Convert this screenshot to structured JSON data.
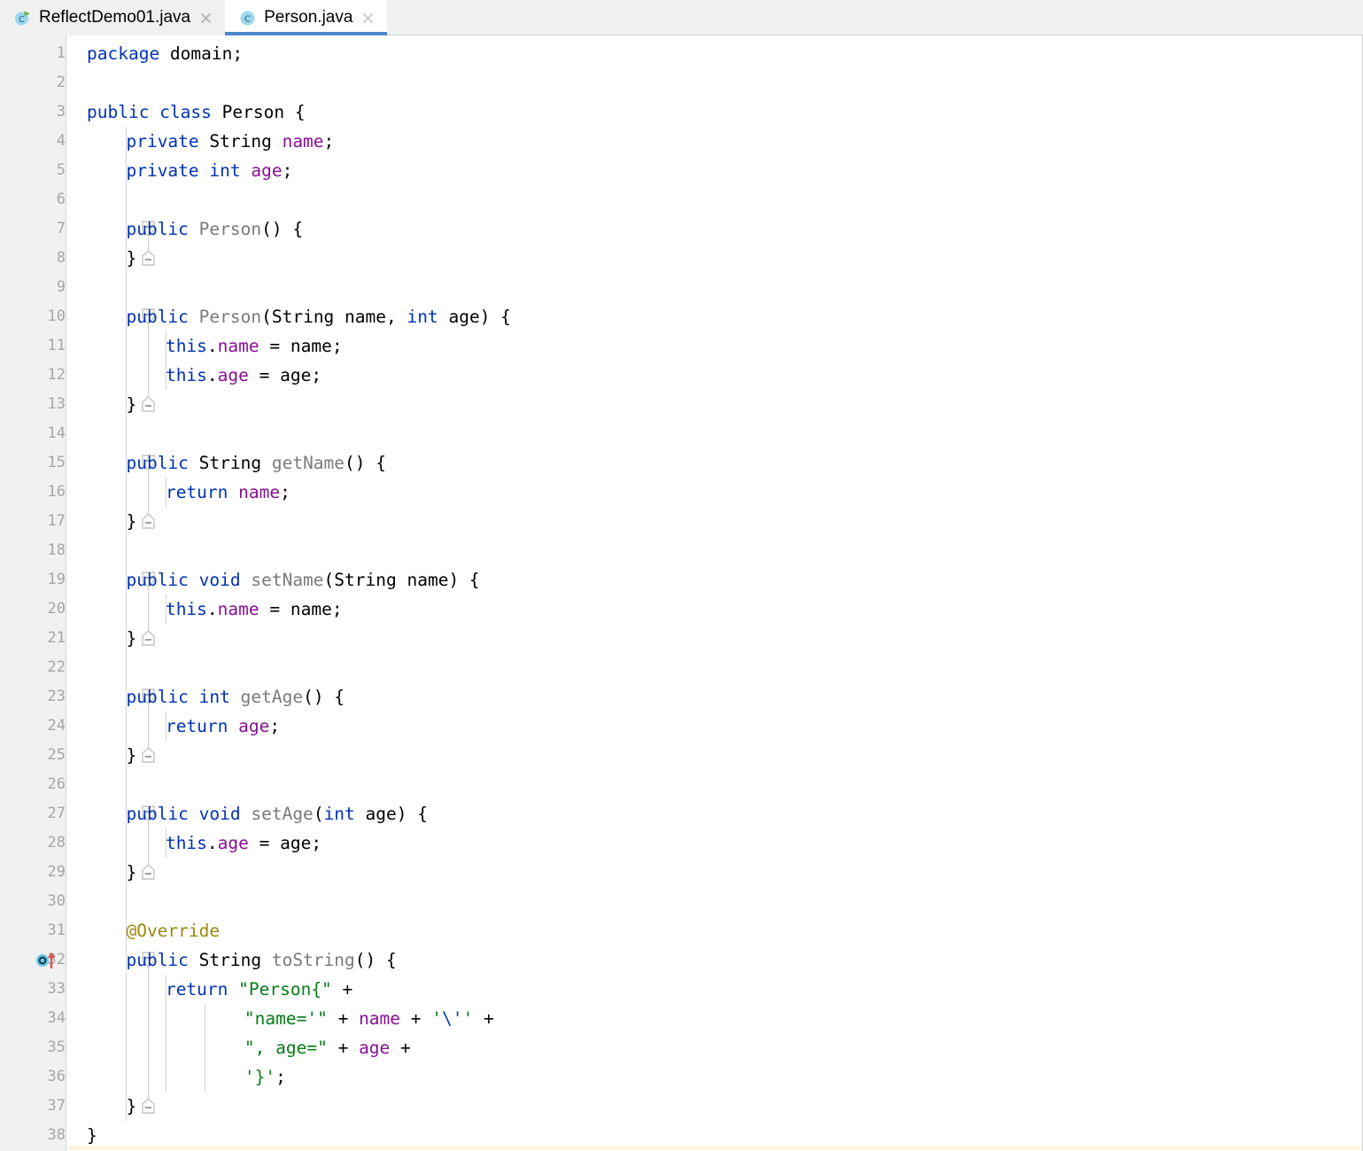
{
  "window": {
    "app": "IntelliJ IDEA",
    "active_file": "Person.java"
  },
  "tabs": [
    {
      "label": "ReflectDemo01.java",
      "icon": "java-runnable-class-icon",
      "active": false,
      "close_icon": "close-icon"
    },
    {
      "label": "Person.java",
      "icon": "java-class-icon",
      "active": true,
      "close_icon": "close-icon"
    }
  ],
  "editor": {
    "language": "java",
    "first_line": 1,
    "last_line": 38,
    "gutter_icons": [
      {
        "line": 32,
        "icon": "overriding-method-icon",
        "tooltip": "Overrides method in Object"
      }
    ],
    "lines": [
      {
        "n": 1,
        "indent": 0,
        "tokens": [
          {
            "t": "package ",
            "c": "kw"
          },
          {
            "t": "domain;",
            "c": "typ"
          }
        ]
      },
      {
        "n": 2,
        "indent": 0,
        "tokens": []
      },
      {
        "n": 3,
        "indent": 0,
        "tokens": [
          {
            "t": "public ",
            "c": "kw"
          },
          {
            "t": "class ",
            "c": "kw"
          },
          {
            "t": "Person {",
            "c": "typ"
          }
        ]
      },
      {
        "n": 4,
        "indent": 1,
        "tokens": [
          {
            "t": "private ",
            "c": "kw"
          },
          {
            "t": "String ",
            "c": "cls"
          },
          {
            "t": "name",
            "c": "fld"
          },
          {
            "t": ";",
            "c": "typ"
          }
        ]
      },
      {
        "n": 5,
        "indent": 1,
        "tokens": [
          {
            "t": "private ",
            "c": "kw"
          },
          {
            "t": "int ",
            "c": "kw"
          },
          {
            "t": "age",
            "c": "fld"
          },
          {
            "t": ";",
            "c": "typ"
          }
        ]
      },
      {
        "n": 6,
        "indent": 0,
        "tokens": []
      },
      {
        "n": 7,
        "indent": 1,
        "tokens": [
          {
            "t": "public ",
            "c": "kw"
          },
          {
            "t": "Person",
            "c": "mth"
          },
          {
            "t": "() {",
            "c": "typ"
          }
        ]
      },
      {
        "n": 8,
        "indent": 1,
        "tokens": [
          {
            "t": "}",
            "c": "typ"
          }
        ]
      },
      {
        "n": 9,
        "indent": 0,
        "tokens": []
      },
      {
        "n": 10,
        "indent": 1,
        "tokens": [
          {
            "t": "public ",
            "c": "kw"
          },
          {
            "t": "Person",
            "c": "mth"
          },
          {
            "t": "(",
            "c": "typ"
          },
          {
            "t": "String",
            "c": "cls"
          },
          {
            "t": " name, ",
            "c": "typ"
          },
          {
            "t": "int",
            "c": "kw"
          },
          {
            "t": " age) {",
            "c": "typ"
          }
        ]
      },
      {
        "n": 11,
        "indent": 2,
        "tokens": [
          {
            "t": "this",
            "c": "kw"
          },
          {
            "t": ".",
            "c": "typ"
          },
          {
            "t": "name",
            "c": "fld"
          },
          {
            "t": " = name;",
            "c": "typ"
          }
        ]
      },
      {
        "n": 12,
        "indent": 2,
        "tokens": [
          {
            "t": "this",
            "c": "kw"
          },
          {
            "t": ".",
            "c": "typ"
          },
          {
            "t": "age",
            "c": "fld"
          },
          {
            "t": " = age;",
            "c": "typ"
          }
        ]
      },
      {
        "n": 13,
        "indent": 1,
        "tokens": [
          {
            "t": "}",
            "c": "typ"
          }
        ]
      },
      {
        "n": 14,
        "indent": 0,
        "tokens": []
      },
      {
        "n": 15,
        "indent": 1,
        "tokens": [
          {
            "t": "public ",
            "c": "kw"
          },
          {
            "t": "String ",
            "c": "cls"
          },
          {
            "t": "getName",
            "c": "mth"
          },
          {
            "t": "() {",
            "c": "typ"
          }
        ]
      },
      {
        "n": 16,
        "indent": 2,
        "tokens": [
          {
            "t": "return ",
            "c": "kw"
          },
          {
            "t": "name",
            "c": "fld"
          },
          {
            "t": ";",
            "c": "typ"
          }
        ]
      },
      {
        "n": 17,
        "indent": 1,
        "tokens": [
          {
            "t": "}",
            "c": "typ"
          }
        ]
      },
      {
        "n": 18,
        "indent": 0,
        "tokens": []
      },
      {
        "n": 19,
        "indent": 1,
        "tokens": [
          {
            "t": "public ",
            "c": "kw"
          },
          {
            "t": "void ",
            "c": "kw"
          },
          {
            "t": "setName",
            "c": "mth"
          },
          {
            "t": "(",
            "c": "typ"
          },
          {
            "t": "String",
            "c": "cls"
          },
          {
            "t": " name) {",
            "c": "typ"
          }
        ]
      },
      {
        "n": 20,
        "indent": 2,
        "tokens": [
          {
            "t": "this",
            "c": "kw"
          },
          {
            "t": ".",
            "c": "typ"
          },
          {
            "t": "name",
            "c": "fld"
          },
          {
            "t": " = name;",
            "c": "typ"
          }
        ]
      },
      {
        "n": 21,
        "indent": 1,
        "tokens": [
          {
            "t": "}",
            "c": "typ"
          }
        ]
      },
      {
        "n": 22,
        "indent": 0,
        "tokens": []
      },
      {
        "n": 23,
        "indent": 1,
        "tokens": [
          {
            "t": "public ",
            "c": "kw"
          },
          {
            "t": "int ",
            "c": "kw"
          },
          {
            "t": "getAge",
            "c": "mth"
          },
          {
            "t": "() {",
            "c": "typ"
          }
        ]
      },
      {
        "n": 24,
        "indent": 2,
        "tokens": [
          {
            "t": "return ",
            "c": "kw"
          },
          {
            "t": "age",
            "c": "fld"
          },
          {
            "t": ";",
            "c": "typ"
          }
        ]
      },
      {
        "n": 25,
        "indent": 1,
        "tokens": [
          {
            "t": "}",
            "c": "typ"
          }
        ]
      },
      {
        "n": 26,
        "indent": 0,
        "tokens": []
      },
      {
        "n": 27,
        "indent": 1,
        "tokens": [
          {
            "t": "public ",
            "c": "kw"
          },
          {
            "t": "void ",
            "c": "kw"
          },
          {
            "t": "setAge",
            "c": "mth"
          },
          {
            "t": "(",
            "c": "typ"
          },
          {
            "t": "int",
            "c": "kw"
          },
          {
            "t": " age) {",
            "c": "typ"
          }
        ]
      },
      {
        "n": 28,
        "indent": 2,
        "tokens": [
          {
            "t": "this",
            "c": "kw"
          },
          {
            "t": ".",
            "c": "typ"
          },
          {
            "t": "age",
            "c": "fld"
          },
          {
            "t": " = age;",
            "c": "typ"
          }
        ]
      },
      {
        "n": 29,
        "indent": 1,
        "tokens": [
          {
            "t": "}",
            "c": "typ"
          }
        ]
      },
      {
        "n": 30,
        "indent": 0,
        "tokens": []
      },
      {
        "n": 31,
        "indent": 1,
        "tokens": [
          {
            "t": "@Override",
            "c": "ann"
          }
        ]
      },
      {
        "n": 32,
        "indent": 1,
        "tokens": [
          {
            "t": "public ",
            "c": "kw"
          },
          {
            "t": "String ",
            "c": "cls"
          },
          {
            "t": "toString",
            "c": "mth"
          },
          {
            "t": "() {",
            "c": "typ"
          }
        ]
      },
      {
        "n": 33,
        "indent": 2,
        "tokens": [
          {
            "t": "return ",
            "c": "kw"
          },
          {
            "t": "\"Person{\"",
            "c": "str"
          },
          {
            "t": " +",
            "c": "typ"
          }
        ]
      },
      {
        "n": 34,
        "indent": 4,
        "tokens": [
          {
            "t": "\"name='\"",
            "c": "str"
          },
          {
            "t": " + ",
            "c": "typ"
          },
          {
            "t": "name",
            "c": "fld"
          },
          {
            "t": " + ",
            "c": "typ"
          },
          {
            "t": "'",
            "c": "str"
          },
          {
            "t": "\\'",
            "c": "esc"
          },
          {
            "t": "'",
            "c": "str"
          },
          {
            "t": " +",
            "c": "typ"
          }
        ]
      },
      {
        "n": 35,
        "indent": 4,
        "tokens": [
          {
            "t": "\", age=\"",
            "c": "str"
          },
          {
            "t": " + ",
            "c": "typ"
          },
          {
            "t": "age",
            "c": "fld"
          },
          {
            "t": " +",
            "c": "typ"
          }
        ]
      },
      {
        "n": 36,
        "indent": 4,
        "tokens": [
          {
            "t": "'}'",
            "c": "str"
          },
          {
            "t": ";",
            "c": "typ"
          }
        ]
      },
      {
        "n": 37,
        "indent": 1,
        "tokens": [
          {
            "t": "}",
            "c": "typ"
          }
        ]
      },
      {
        "n": 38,
        "indent": 0,
        "tokens": [
          {
            "t": "}",
            "c": "typ"
          }
        ]
      }
    ],
    "fold_regions": [
      {
        "start": 7,
        "end": 8
      },
      {
        "start": 10,
        "end": 13
      },
      {
        "start": 15,
        "end": 17
      },
      {
        "start": 19,
        "end": 21
      },
      {
        "start": 23,
        "end": 25
      },
      {
        "start": 27,
        "end": 29
      },
      {
        "start": 32,
        "end": 37
      }
    ],
    "indent_guides": [
      {
        "level": 1,
        "from": 4,
        "to": 37
      },
      {
        "level": 2,
        "from": 11,
        "to": 12
      },
      {
        "level": 2,
        "from": 16,
        "to": 16
      },
      {
        "level": 2,
        "from": 20,
        "to": 20
      },
      {
        "level": 2,
        "from": 24,
        "to": 24
      },
      {
        "level": 2,
        "from": 28,
        "to": 28
      },
      {
        "level": 2,
        "from": 33,
        "to": 36
      },
      {
        "level": 3,
        "from": 34,
        "to": 36
      }
    ]
  },
  "colors": {
    "keyword": "#0033b3",
    "field": "#871094",
    "method": "#7a7a7a",
    "string": "#067d17",
    "escape": "#0037a6",
    "annotation": "#9e880d",
    "gutter_bg": "#f1f1f1",
    "line_number": "#a6a6a6",
    "tab_active_underline": "#4a88c7",
    "editor_bg": "#ffffff"
  }
}
